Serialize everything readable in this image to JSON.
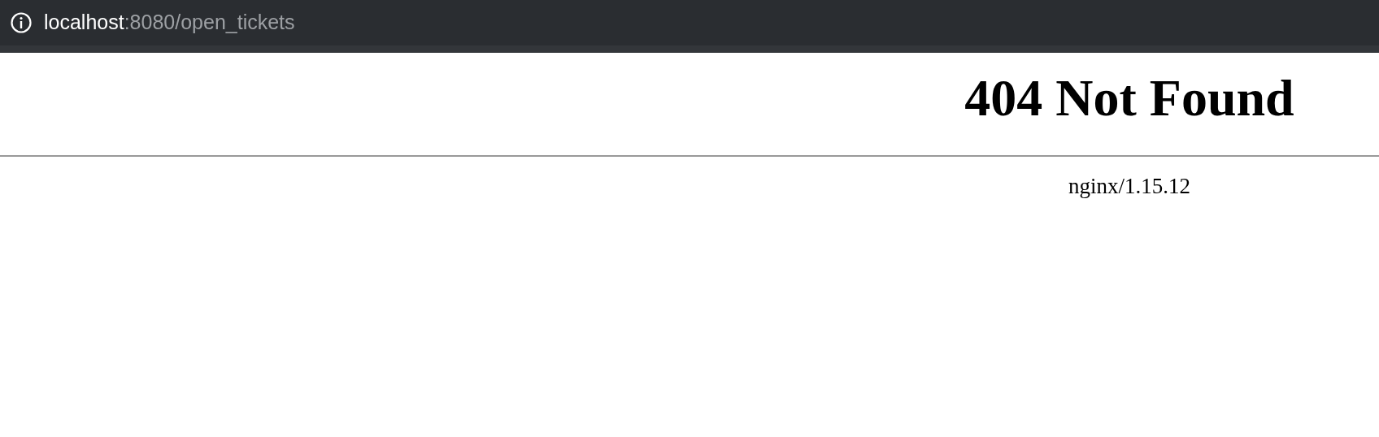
{
  "address_bar": {
    "host": "localhost",
    "path": ":8080/open_tickets"
  },
  "page": {
    "heading": "404 Not Found",
    "server": "nginx/1.15.12"
  }
}
